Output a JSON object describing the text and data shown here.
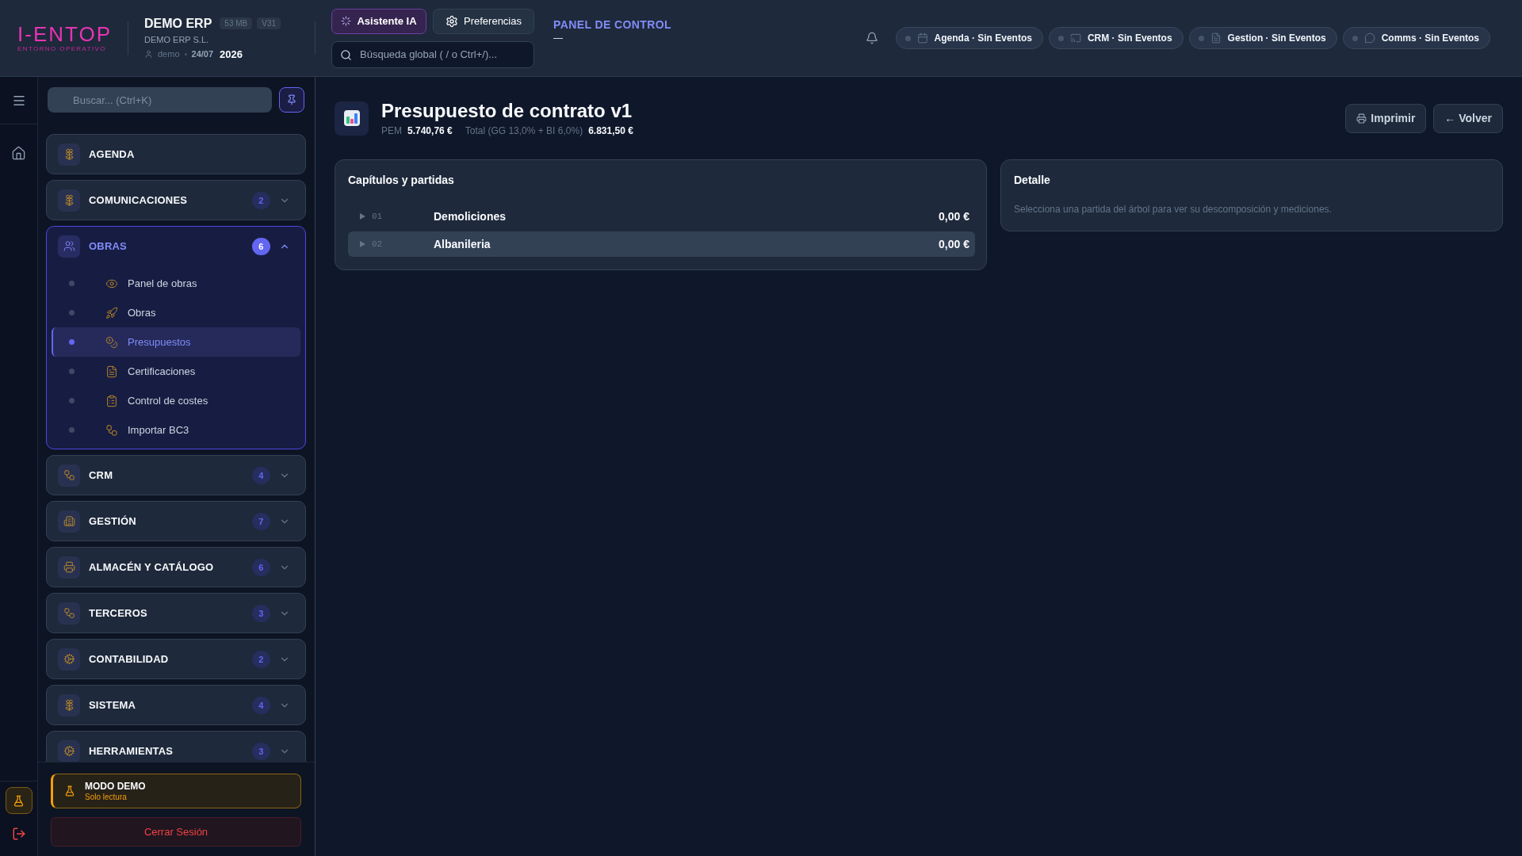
{
  "top_bar": {
    "logo": {
      "wordmark": "I-ENTOP",
      "tagline": "ENTORNO OPERATIVO"
    },
    "company": {
      "app_name": "DEMO ERP",
      "size_badge": "53 MB",
      "version_badge": "V31",
      "legal_name": "DEMO ERP S.L.",
      "user": "demo",
      "date": "24/07",
      "year": "2026"
    },
    "assistant_button": "Asistente IA",
    "preferences_button": "Preferencias",
    "global_search": {
      "placeholder": "Búsqueda global ( / o Ctrl+/)..."
    },
    "context": {
      "title": "PANEL DE CONTROL",
      "subtitle": "—"
    },
    "event_chips": [
      {
        "label": "Agenda · Sin Eventos"
      },
      {
        "label": "CRM · Sin Eventos"
      },
      {
        "label": "Gestion · Sin Eventos"
      },
      {
        "label": "Comms · Sin Eventos"
      }
    ]
  },
  "sidebar": {
    "search": {
      "placeholder": "Buscar... (Ctrl+K)"
    },
    "groups": [
      {
        "kind": "link",
        "label": "AGENDA",
        "expanded": false
      },
      {
        "kind": "group",
        "label": "COMUNICACIONES",
        "count": "2",
        "expanded": false
      },
      {
        "kind": "group",
        "label": "OBRAS",
        "count": "6",
        "expanded": true,
        "children": [
          {
            "label": "Panel de obras",
            "selected": false
          },
          {
            "label": "Obras",
            "selected": false
          },
          {
            "label": "Presupuestos",
            "selected": true
          },
          {
            "label": "Certificaciones",
            "selected": false
          },
          {
            "label": "Control de costes",
            "selected": false
          },
          {
            "label": "Importar BC3",
            "selected": false
          }
        ]
      },
      {
        "kind": "group",
        "label": "CRM",
        "count": "4",
        "expanded": false
      },
      {
        "kind": "group",
        "label": "GESTIÓN",
        "count": "7",
        "expanded": false
      },
      {
        "kind": "group",
        "label": "ALMACÉN Y CATÁLOGO",
        "count": "6",
        "expanded": false
      },
      {
        "kind": "group",
        "label": "TERCEROS",
        "count": "3",
        "expanded": false
      },
      {
        "kind": "group",
        "label": "CONTABILIDAD",
        "count": "2",
        "expanded": false
      },
      {
        "kind": "group",
        "label": "SISTEMA",
        "count": "4",
        "expanded": false
      },
      {
        "kind": "group",
        "label": "HERRAMIENTAS",
        "count": "3",
        "expanded": false
      }
    ],
    "demo_notice": {
      "title": "MODO DEMO",
      "subtitle": "Solo lectura"
    },
    "logout_button": "Cerrar Sesión"
  },
  "page": {
    "title": "Presupuesto de contrato v1",
    "summary": [
      {
        "label": "PEM",
        "value": "5.740,76 €"
      },
      {
        "label": "Total (GG 13,0% + BI 6,0%)",
        "value": "6.831,50 €"
      }
    ],
    "actions": [
      {
        "kind": "print",
        "label": "Imprimir"
      },
      {
        "kind": "back",
        "label": "← Volver"
      }
    ]
  },
  "chapters_panel": {
    "title": "Capítulos y partidas",
    "rows": [
      {
        "code": "01",
        "name": "Demoliciones",
        "amount": "0,00 €",
        "highlighted": false
      },
      {
        "code": "02",
        "name": "Albanileria",
        "amount": "0,00 €",
        "highlighted": true
      }
    ]
  },
  "detail_panel": {
    "title": "Detalle",
    "message": "Selecciona una partida del árbol para ver su descomposición y mediciones."
  }
}
